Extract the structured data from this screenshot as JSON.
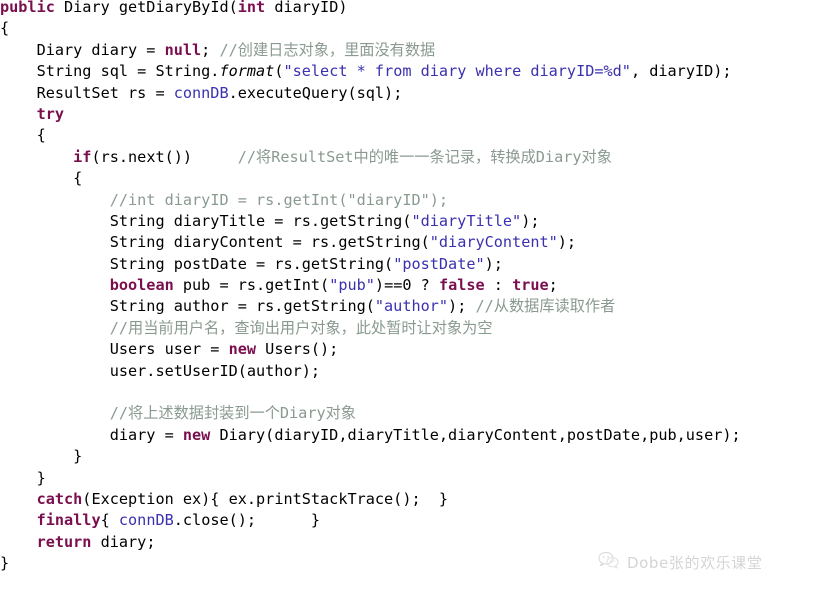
{
  "editor": {
    "background_color": "#ffffff",
    "plain_color": "#000000",
    "keyword_color": "#7a0f4e",
    "string_color": "#3a30b0",
    "comment_color": "#8a9a90",
    "field_color": "#3a30b0",
    "language": "Java"
  },
  "code": {
    "lines": [
      [
        {
          "t": "public",
          "c": "kw"
        },
        {
          "t": " Diary getDiaryById(",
          "c": "pln"
        },
        {
          "t": "int",
          "c": "kw"
        },
        {
          "t": " diaryID)",
          "c": "pln"
        }
      ],
      [
        {
          "t": "{",
          "c": "pln"
        }
      ],
      [
        {
          "t": "    Diary diary = ",
          "c": "pln"
        },
        {
          "t": "null",
          "c": "kw"
        },
        {
          "t": "; ",
          "c": "pln"
        },
        {
          "t": "//创建日志对象，里面没有数据",
          "c": "cmt"
        }
      ],
      [
        {
          "t": "    String sql = String.",
          "c": "pln"
        },
        {
          "t": "format",
          "c": "stm"
        },
        {
          "t": "(",
          "c": "pln"
        },
        {
          "t": "\"select * from diary where diaryID=%d\"",
          "c": "str"
        },
        {
          "t": ", diaryID);",
          "c": "pln"
        }
      ],
      [
        {
          "t": "    ResultSet rs = ",
          "c": "pln"
        },
        {
          "t": "connDB",
          "c": "fld"
        },
        {
          "t": ".executeQuery(sql);",
          "c": "pln"
        }
      ],
      [
        {
          "t": "    ",
          "c": "pln"
        },
        {
          "t": "try",
          "c": "kw"
        }
      ],
      [
        {
          "t": "    {",
          "c": "pln"
        }
      ],
      [
        {
          "t": "        ",
          "c": "pln"
        },
        {
          "t": "if",
          "c": "kw"
        },
        {
          "t": "(rs.next())     ",
          "c": "pln"
        },
        {
          "t": "//将ResultSet中的唯一一条记录，转换成Diary对象",
          "c": "cmt"
        }
      ],
      [
        {
          "t": "        {",
          "c": "pln"
        }
      ],
      [
        {
          "t": "            ",
          "c": "pln"
        },
        {
          "t": "//int diaryID = rs.getInt(\"diaryID\");",
          "c": "cmt"
        }
      ],
      [
        {
          "t": "            String diaryTitle = rs.getString(",
          "c": "pln"
        },
        {
          "t": "\"diaryTitle\"",
          "c": "str"
        },
        {
          "t": ");",
          "c": "pln"
        }
      ],
      [
        {
          "t": "            String diaryContent = rs.getString(",
          "c": "pln"
        },
        {
          "t": "\"diaryContent\"",
          "c": "str"
        },
        {
          "t": ");",
          "c": "pln"
        }
      ],
      [
        {
          "t": "            String postDate = rs.getString(",
          "c": "pln"
        },
        {
          "t": "\"postDate\"",
          "c": "str"
        },
        {
          "t": ");",
          "c": "pln"
        }
      ],
      [
        {
          "t": "            ",
          "c": "pln"
        },
        {
          "t": "boolean",
          "c": "kw"
        },
        {
          "t": " pub = rs.getInt(",
          "c": "pln"
        },
        {
          "t": "\"pub\"",
          "c": "str"
        },
        {
          "t": ")==0 ? ",
          "c": "pln"
        },
        {
          "t": "false",
          "c": "kw"
        },
        {
          "t": " : ",
          "c": "pln"
        },
        {
          "t": "true",
          "c": "kw"
        },
        {
          "t": ";",
          "c": "pln"
        }
      ],
      [
        {
          "t": "            String author = rs.getString(",
          "c": "pln"
        },
        {
          "t": "\"author\"",
          "c": "str"
        },
        {
          "t": "); ",
          "c": "pln"
        },
        {
          "t": "//从数据库读取作者",
          "c": "cmt"
        }
      ],
      [
        {
          "t": "            ",
          "c": "pln"
        },
        {
          "t": "//用当前用户名，查询出用户对象，此处暂时让对象为空",
          "c": "cmt"
        }
      ],
      [
        {
          "t": "            Users user = ",
          "c": "pln"
        },
        {
          "t": "new",
          "c": "kw"
        },
        {
          "t": " Users();",
          "c": "pln"
        }
      ],
      [
        {
          "t": "            user.setUserID(author);",
          "c": "pln"
        }
      ],
      [
        {
          "t": "",
          "c": "pln"
        }
      ],
      [
        {
          "t": "            ",
          "c": "pln"
        },
        {
          "t": "//将上述数据封装到一个Diary对象",
          "c": "cmt"
        }
      ],
      [
        {
          "t": "            diary = ",
          "c": "pln"
        },
        {
          "t": "new",
          "c": "kw"
        },
        {
          "t": " Diary(diaryID,diaryTitle,diaryContent,postDate,pub,user);",
          "c": "pln"
        }
      ],
      [
        {
          "t": "        }",
          "c": "pln"
        }
      ],
      [
        {
          "t": "    }",
          "c": "pln"
        }
      ],
      [
        {
          "t": "    ",
          "c": "pln"
        },
        {
          "t": "catch",
          "c": "kw"
        },
        {
          "t": "(Exception ex){ ex.printStackTrace();  }",
          "c": "pln"
        }
      ],
      [
        {
          "t": "    ",
          "c": "pln"
        },
        {
          "t": "finally",
          "c": "kw"
        },
        {
          "t": "{ ",
          "c": "pln"
        },
        {
          "t": "connDB",
          "c": "fld"
        },
        {
          "t": ".close();      }",
          "c": "pln"
        }
      ],
      [
        {
          "t": "    ",
          "c": "pln"
        },
        {
          "t": "return",
          "c": "kw"
        },
        {
          "t": " diary;",
          "c": "pln"
        }
      ],
      [
        {
          "t": "}",
          "c": "pln"
        }
      ]
    ]
  },
  "watermark": {
    "text": "Dobe张的欢乐课堂",
    "icon": "wechat-icon",
    "color": "#9b9b9b"
  }
}
